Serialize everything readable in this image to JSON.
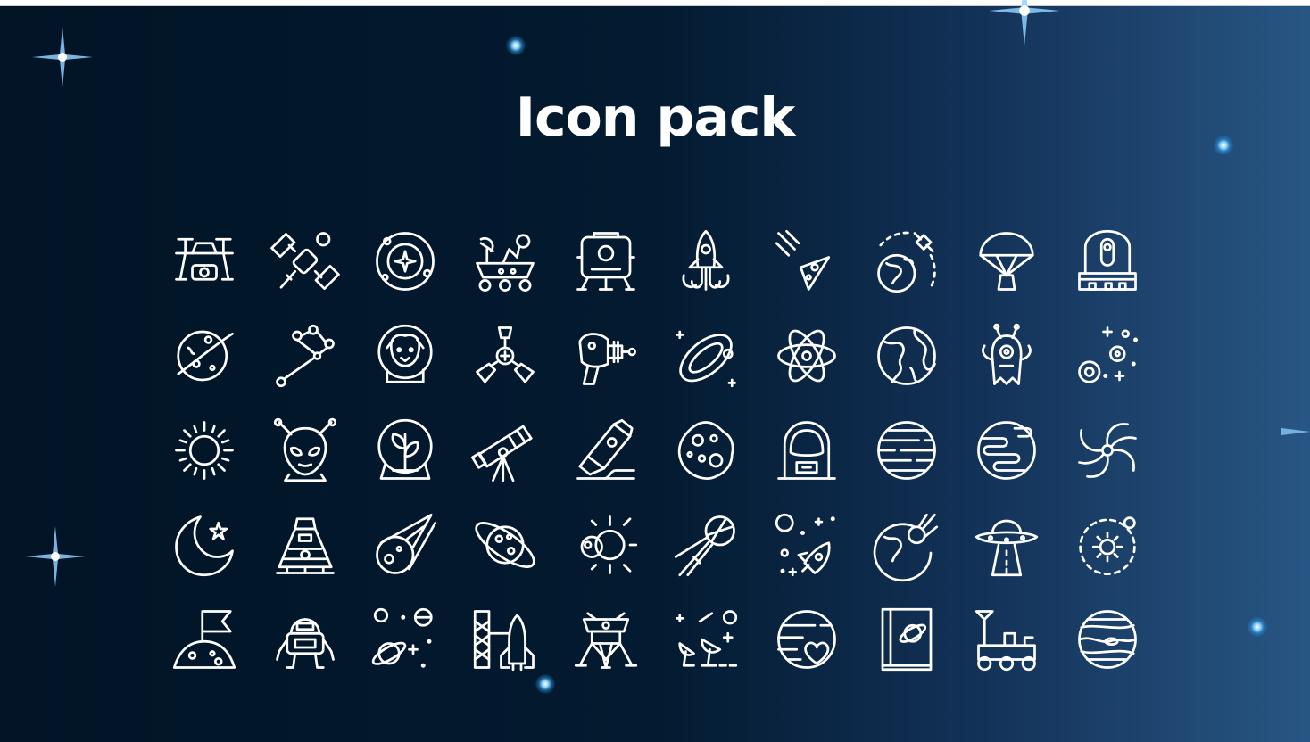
{
  "page": {
    "title": "Icon pack",
    "background_colors": [
      "#021426",
      "#031a30",
      "#133258",
      "#285684"
    ],
    "icon_color": "#ffffff"
  },
  "icons": [
    [
      "drone-icon",
      "satellite-icon",
      "solar-system-icon",
      "mars-rover-icon",
      "space-capsule-icon",
      "rocket-launch-icon",
      "meteor-shower-icon",
      "orbiting-satellite-icon",
      "parachute-capsule-icon",
      "observatory-icon"
    ],
    [
      "ringed-planet-icon",
      "constellation-icon",
      "astronaut-dog-icon",
      "space-station-module-icon",
      "ray-gun-icon",
      "galaxy-orbit-icon",
      "atom-icon",
      "earth-icon",
      "alien-creature-icon",
      "planet-system-icon"
    ],
    [
      "sun-icon",
      "alien-head-icon",
      "plant-dome-icon",
      "telescope-icon",
      "launch-pad-rocket-icon",
      "moon-crater-icon",
      "astronaut-helmet-icon",
      "gas-giant-icon",
      "earth-map-icon",
      "black-hole-icon"
    ],
    [
      "crescent-moon-star-icon",
      "lander-pod-icon",
      "comet-icon",
      "saturn-icon",
      "eclipse-icon",
      "sputnik-icon",
      "rocket-stars-icon",
      "asteroid-impact-icon",
      "ufo-beam-icon",
      "orbit-sun-icon"
    ],
    [
      "moon-flag-icon",
      "robot-icon",
      "planets-icon",
      "shuttle-tower-icon",
      "lunar-module-icon",
      "radio-telescopes-icon",
      "love-planet-icon",
      "space-book-icon",
      "lunar-rover-icon",
      "jupiter-icon"
    ]
  ]
}
